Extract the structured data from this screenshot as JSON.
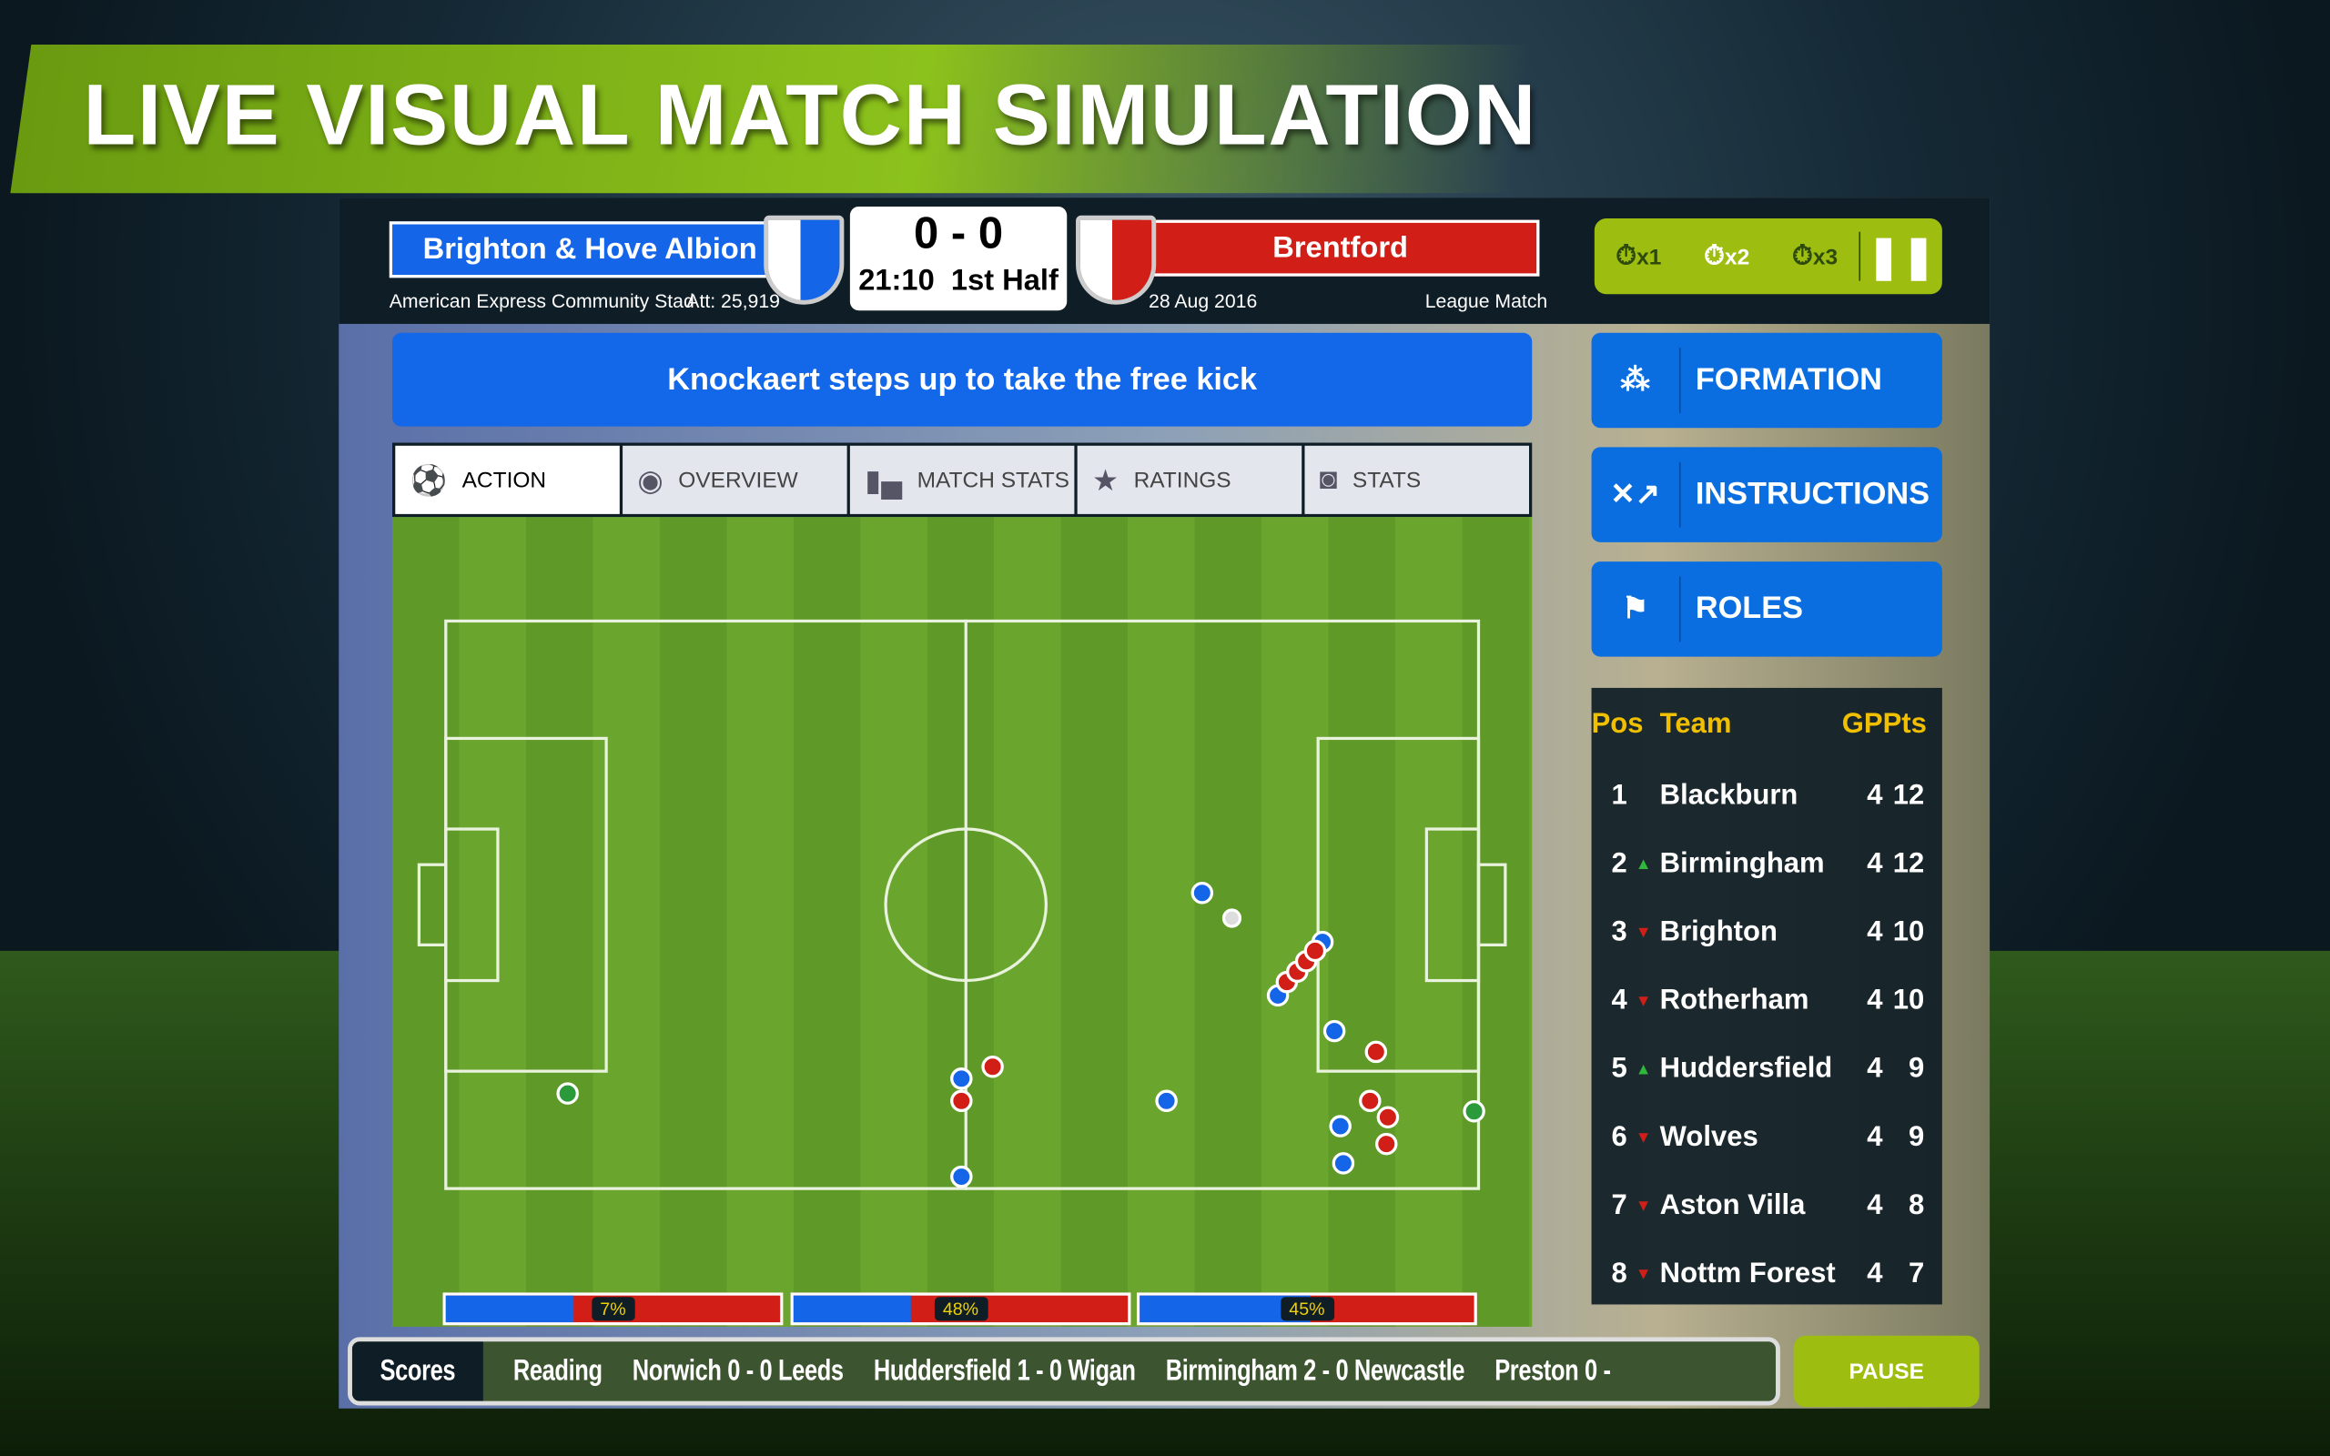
{
  "banner": {
    "title": "LIVE VISUAL MATCH SIMULATION"
  },
  "match": {
    "home": "Brighton & Hove Albion",
    "away": "Brentford",
    "score": "0 - 0",
    "clock": "21:10",
    "period": "1st Half",
    "stadium": "American Express Community Stad",
    "attendance": "Att: 25,919",
    "date": "28 Aug 2016",
    "type": "League Match",
    "home_color": "#1565e8",
    "away_color": "#d11f18"
  },
  "speed": {
    "x1": "x1",
    "x2": "x2",
    "x3": "x3"
  },
  "event": "Knockaert steps up to take the free kick",
  "tabs": [
    {
      "label": "ACTION",
      "icon": "kicker-icon"
    },
    {
      "label": "OVERVIEW",
      "icon": "eye-icon"
    },
    {
      "label": "MATCH STATS",
      "icon": "bar-chart-icon"
    },
    {
      "label": "RATINGS",
      "icon": "star-icon"
    },
    {
      "label": "STATS",
      "icon": "player-stats-icon"
    }
  ],
  "bars": [
    {
      "label": "7%",
      "home_fill": 0.38
    },
    {
      "label": "48%",
      "home_fill": 0.35
    },
    {
      "label": "45%",
      "home_fill": 0.51
    }
  ],
  "side": {
    "formation": "FORMATION",
    "instructions": "INSTRUCTIONS",
    "roles": "ROLES"
  },
  "league": {
    "headers": {
      "pos": "Pos",
      "team": "Team",
      "gp": "GP",
      "pts": "Pts"
    },
    "rows": [
      {
        "pos": "1",
        "trend": "",
        "team": "Blackburn",
        "gp": "4",
        "pts": "12"
      },
      {
        "pos": "2",
        "trend": "up",
        "team": "Birmingham",
        "gp": "4",
        "pts": "12"
      },
      {
        "pos": "3",
        "trend": "down",
        "team": "Brighton",
        "gp": "4",
        "pts": "10"
      },
      {
        "pos": "4",
        "trend": "down",
        "team": "Rotherham",
        "gp": "4",
        "pts": "10"
      },
      {
        "pos": "5",
        "trend": "up",
        "team": "Huddersfield",
        "gp": "4",
        "pts": "9"
      },
      {
        "pos": "6",
        "trend": "down",
        "team": "Wolves",
        "gp": "4",
        "pts": "9"
      },
      {
        "pos": "7",
        "trend": "down",
        "team": "Aston Villa",
        "gp": "4",
        "pts": "8"
      },
      {
        "pos": "8",
        "trend": "down",
        "team": "Nottm Forest",
        "gp": "4",
        "pts": "7"
      }
    ]
  },
  "ticker": {
    "label": "Scores",
    "items": [
      "Reading",
      "Norwich 0 - 0 Leeds",
      "Huddersfield 1 - 0 Wigan",
      "Birmingham 2 - 0 Newcastle",
      "Preston 0 -"
    ]
  },
  "pause_label": "PAUSE"
}
